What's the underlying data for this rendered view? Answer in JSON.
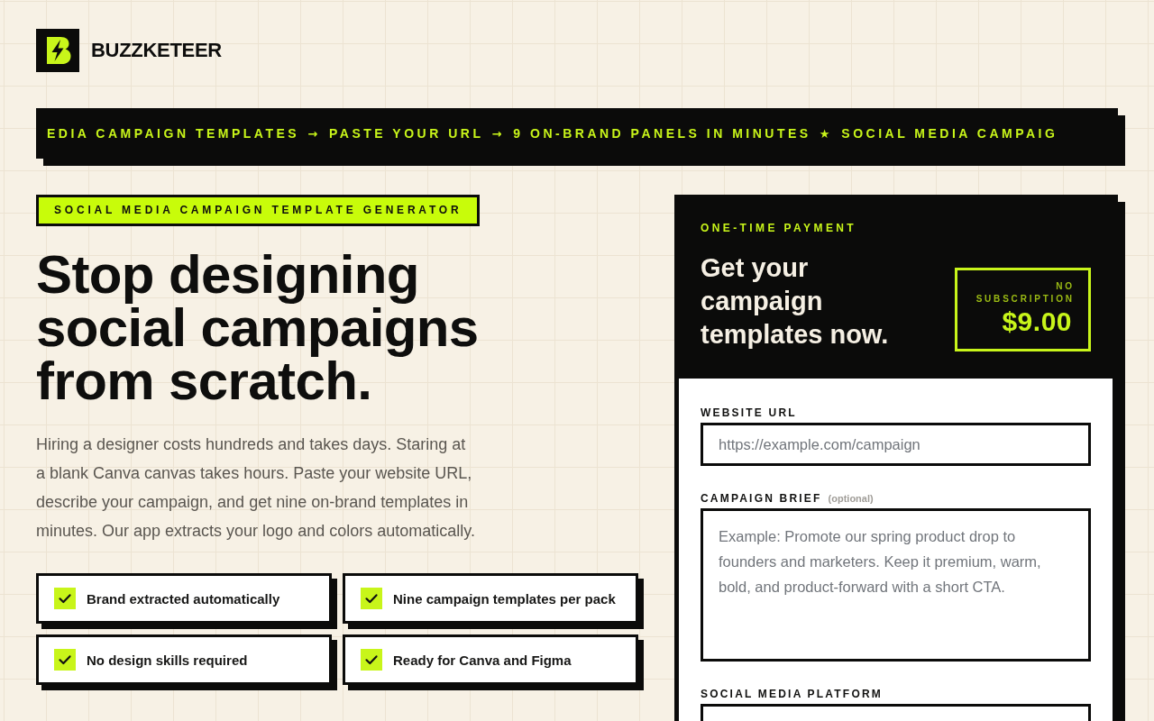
{
  "brand": {
    "name": "BUZZKETEER"
  },
  "ticker": {
    "items": [
      {
        "kind": "text",
        "text": "EDIA CAMPAIGN TEMPLATES"
      },
      {
        "kind": "separator",
        "text": "→"
      },
      {
        "kind": "text",
        "text": "PASTE YOUR URL"
      },
      {
        "kind": "separator",
        "text": "→"
      },
      {
        "kind": "text",
        "text": "9 ON-BRAND PANELS IN MINUTES"
      },
      {
        "kind": "separator",
        "text": "★"
      },
      {
        "kind": "text",
        "text": "SOCIAL MEDIA CAMPAIG"
      }
    ]
  },
  "hero": {
    "eyebrow": "SOCIAL MEDIA CAMPAIGN TEMPLATE GENERATOR",
    "headline": "Stop designing social campaigns from scratch.",
    "description": "Hiring a designer costs hundreds and takes days. Staring at a blank Canva canvas takes hours. Paste your website URL, describe your campaign, and get nine on-brand templates in minutes. Our app extracts your logo and colors automatically.",
    "features": [
      "Brand extracted automatically",
      "Nine campaign templates per pack",
      "No design skills required",
      "Ready for Canva and Figma"
    ]
  },
  "checkout": {
    "eyebrow": "ONE-TIME PAYMENT",
    "title": "Get your campaign templates now.",
    "price_note": "NO SUBSCRIPTION",
    "price": "$9.00",
    "fields": [
      {
        "kind": "input",
        "label": "WEBSITE URL",
        "placeholder": "https://example.com/campaign"
      },
      {
        "kind": "textarea",
        "label": "CAMPAIGN BRIEF",
        "note": "(optional)",
        "placeholder": "Example: Promote our spring product drop to founders and marketers. Keep it premium, warm, bold, and product-forward with a short CTA."
      },
      {
        "kind": "select",
        "label": "SOCIAL MEDIA PLATFORM"
      }
    ]
  }
}
